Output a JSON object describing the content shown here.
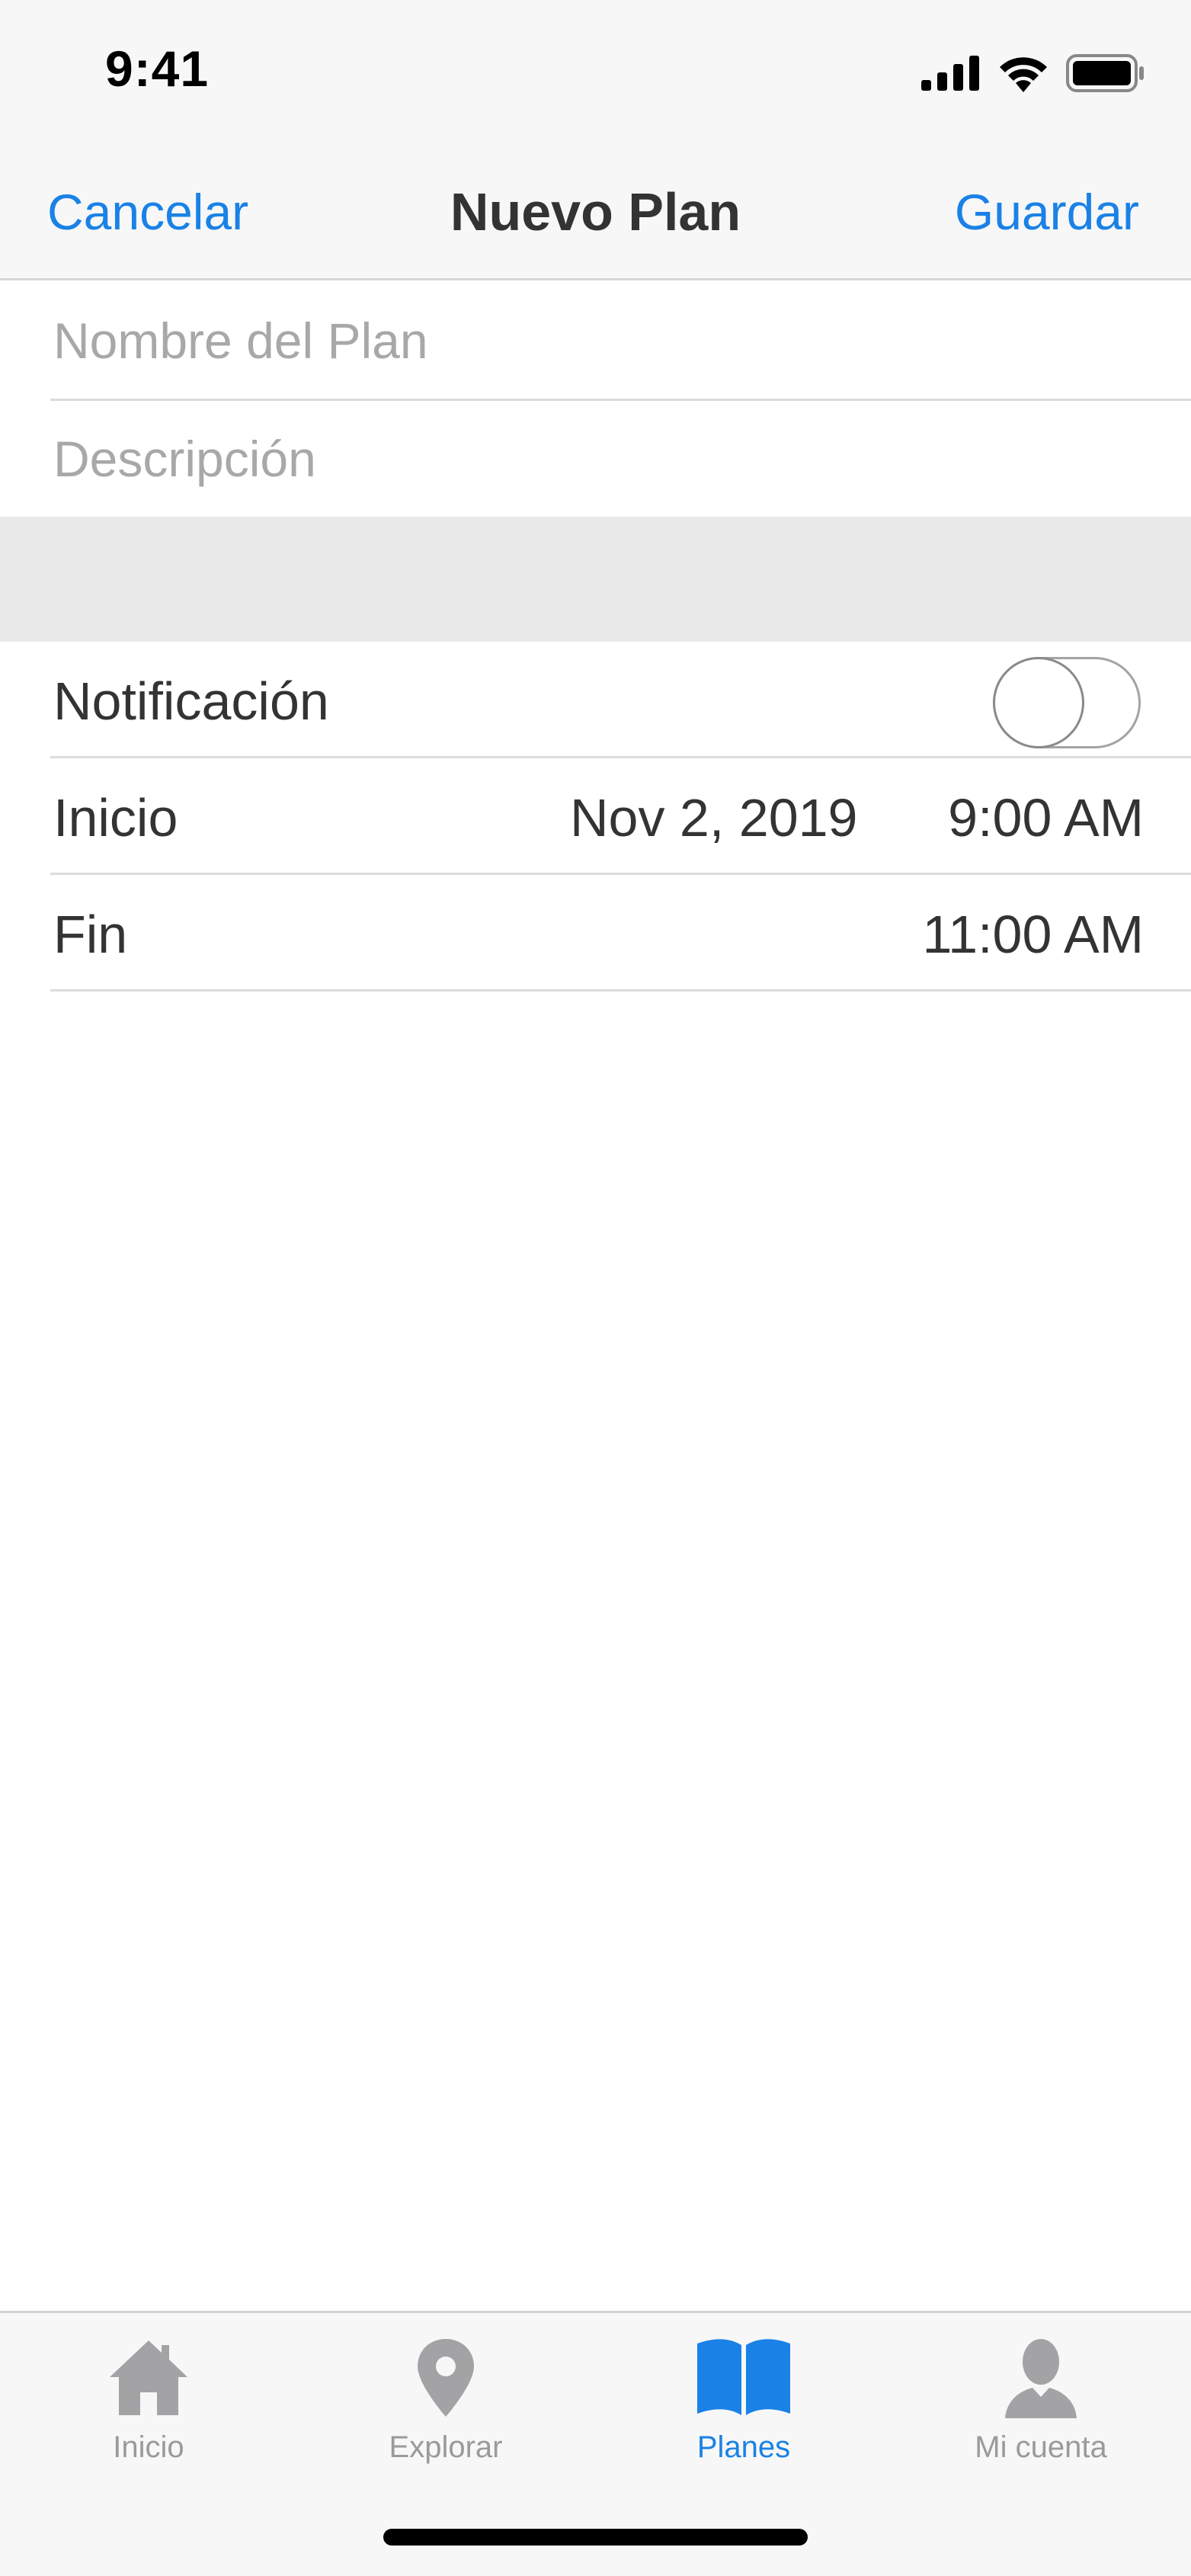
{
  "status_bar": {
    "time": "9:41"
  },
  "nav": {
    "cancel_label": "Cancelar",
    "title": "Nuevo Plan",
    "save_label": "Guardar"
  },
  "form": {
    "name_placeholder": "Nombre del Plan",
    "description_placeholder": "Descripción"
  },
  "settings": {
    "notification": {
      "label": "Notificación",
      "enabled": false
    },
    "start": {
      "label": "Inicio",
      "date": "Nov 2, 2019",
      "time": "9:00 AM"
    },
    "end": {
      "label": "Fin",
      "time": "11:00 AM"
    }
  },
  "tabs": [
    {
      "label": "Inicio",
      "icon": "home-icon",
      "active": false
    },
    {
      "label": "Explorar",
      "icon": "location-pin-icon",
      "active": false
    },
    {
      "label": "Planes",
      "icon": "book-icon",
      "active": true
    },
    {
      "label": "Mi cuenta",
      "icon": "person-icon",
      "active": false
    }
  ],
  "colors": {
    "accent": "#1a82e6",
    "inactive_tab": "#9a9a9a",
    "section_gap": "#e9e9e9"
  }
}
